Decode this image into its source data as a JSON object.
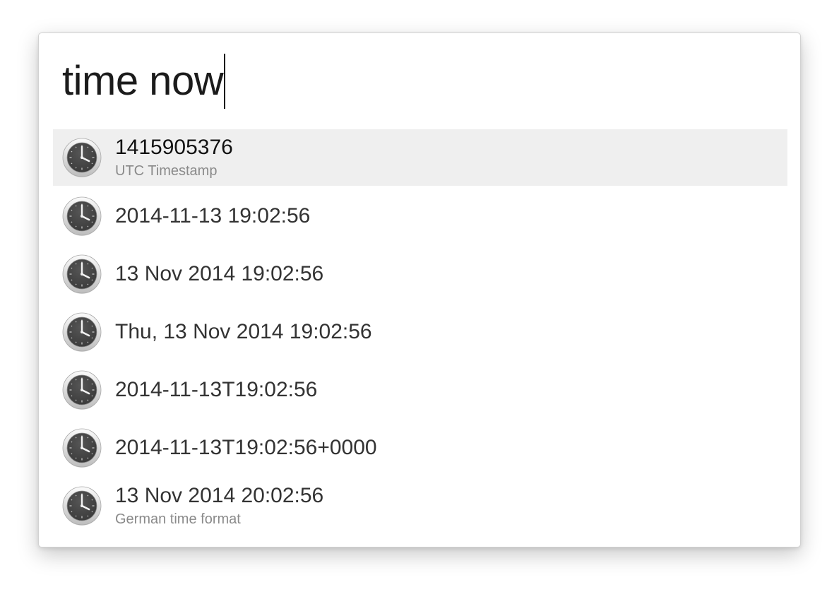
{
  "search": {
    "query": "time now"
  },
  "results": [
    {
      "title": "1415905376",
      "subtitle": "UTC Timestamp",
      "icon": "clock-icon",
      "selected": true
    },
    {
      "title": "2014-11-13 19:02:56",
      "subtitle": "",
      "icon": "clock-icon",
      "selected": false
    },
    {
      "title": "13 Nov 2014 19:02:56",
      "subtitle": "",
      "icon": "clock-icon",
      "selected": false
    },
    {
      "title": "Thu, 13 Nov 2014 19:02:56",
      "subtitle": "",
      "icon": "clock-icon",
      "selected": false
    },
    {
      "title": "2014-11-13T19:02:56",
      "subtitle": "",
      "icon": "clock-icon",
      "selected": false
    },
    {
      "title": "2014-11-13T19:02:56+0000",
      "subtitle": "",
      "icon": "clock-icon",
      "selected": false
    },
    {
      "title": "13 Nov 2014 20:02:56",
      "subtitle": "German time format",
      "icon": "clock-icon",
      "selected": false
    }
  ],
  "colors": {
    "selected_background": "#efefef",
    "title_text": "#333333",
    "subtitle_text": "#8a8a8a",
    "clock_face": "#3a3a3a"
  }
}
